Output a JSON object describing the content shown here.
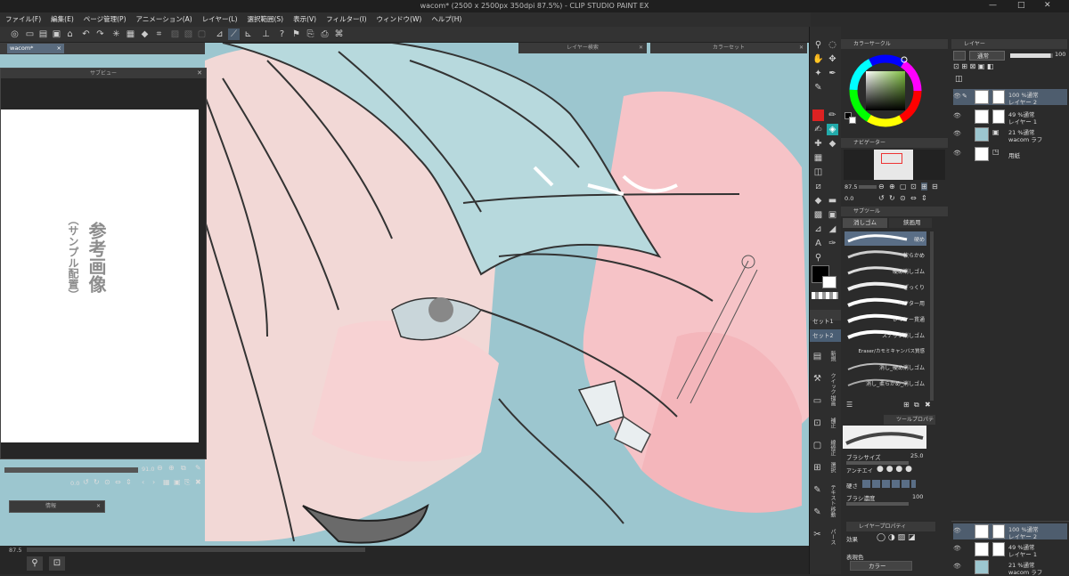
{
  "window": {
    "title": "wacom* (2500 x 2500px 350dpi 87.5%) - CLIP STUDIO PAINT EX",
    "min": "—",
    "max": "□"
  },
  "menu": [
    "ファイル(F)",
    "編集(E)",
    "ページ管理(P)",
    "アニメーション(A)",
    "レイヤー(L)",
    "選択範囲(S)",
    "表示(V)",
    "フィルター(I)",
    "ウィンドウ(W)",
    "ヘルプ(H)"
  ],
  "canvas_tab": {
    "label": "wacom*",
    "close": "×"
  },
  "subview": {
    "title": "サブビュー",
    "ref_title": "参考画像",
    "ref_sub": "（サンプル配置）",
    "zoom": "91.0",
    "angle": "0.0"
  },
  "float_panels": {
    "layer_search": "レイヤー検索",
    "color_set": "カラーセット",
    "info": "情報"
  },
  "status": {
    "zoom": "87.5"
  },
  "color_circle": {
    "title": "カラーサークル"
  },
  "navigator": {
    "title": "ナビゲーター",
    "zoom": "87.5",
    "angle": "0.0"
  },
  "subtool": {
    "title": "サブツール",
    "tabs": [
      "消しゴム",
      "鋏画用"
    ],
    "brushes": [
      "硬め",
      "軟らかめ",
      "硬め消しゴム",
      "ざっくり",
      "ベクター用",
      "レイヤー貫通",
      "スナップ消しゴム",
      "Eraser/カモミキャンバス質感",
      "消し_硬め消しゴム",
      "消し_柔らかめ_消しゴム"
    ]
  },
  "tool_property": {
    "title": "ツールプロパティ",
    "brush_size_label": "ブラシサイズ",
    "brush_size": "25.0",
    "aa_label": "アンチエイ",
    "hardness_label": "硬さ",
    "density_label": "ブラシ濃度",
    "density": "100"
  },
  "layer_property": {
    "title": "レイヤープロパティ",
    "effect_label": "効果",
    "expr_label": "表現色",
    "expr_value": "カラー"
  },
  "tool_sets": [
    "セット1",
    "セット2"
  ],
  "tool_labels": [
    "新規",
    "クイック",
    "描画",
    "補正",
    "線修正",
    "選択",
    "テキスト",
    "移動",
    "パース"
  ],
  "layers_panel": {
    "title": "レイヤー",
    "blend": "通常",
    "opacity": "100",
    "layers": [
      {
        "pct": "100 %通常",
        "name": "レイヤー 2"
      },
      {
        "pct": "49 %通常",
        "name": "レイヤー 1"
      },
      {
        "pct": "21 %通常",
        "name": "wacom ラフ"
      },
      {
        "pct": "",
        "name": "用紙"
      }
    ],
    "mini_layers": [
      {
        "pct": "100 %通常",
        "name": "レイヤー 2"
      },
      {
        "pct": "49 %通常",
        "name": "レイヤー 1"
      },
      {
        "pct": "21 %通常",
        "name": "wacom ラフ"
      }
    ]
  },
  "colors": {
    "accent": "#5a6b7e",
    "fg": "#000000",
    "bg": "#ffffff",
    "canvas_pink": "#f6c3c7",
    "canvas_blue": "#9cc6cf"
  }
}
